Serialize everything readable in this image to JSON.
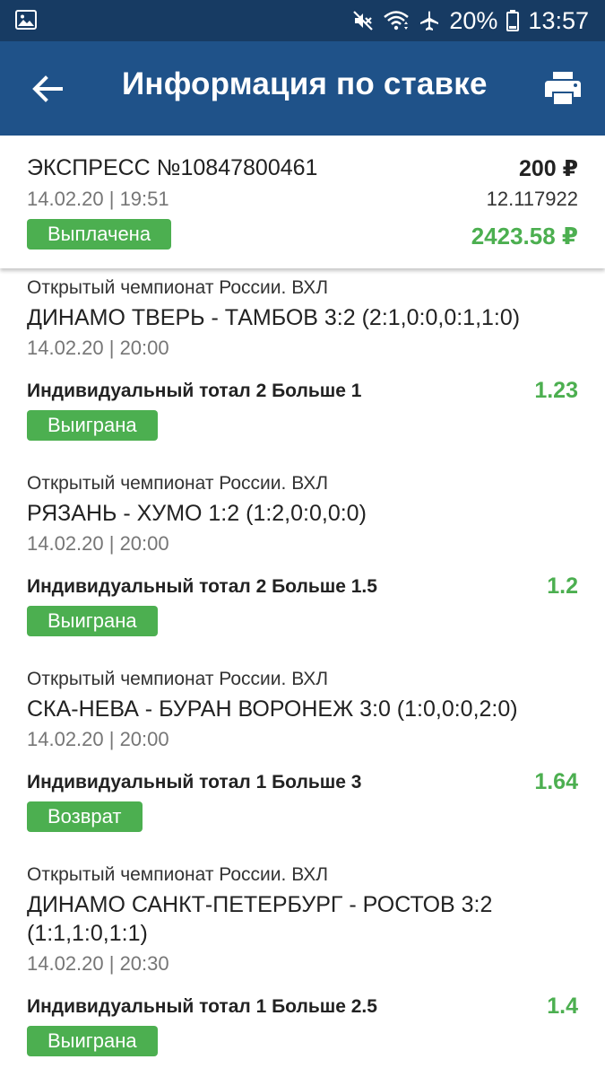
{
  "status_bar": {
    "battery": "20%",
    "time": "13:57",
    "icons": [
      "gallery-icon",
      "mute-icon",
      "wifi-icon",
      "airplane-icon",
      "battery-icon"
    ]
  },
  "app_bar": {
    "title": "Информация по ставке",
    "back_icon": "back-arrow-icon",
    "print_icon": "printer-icon"
  },
  "summary": {
    "bet_name": "ЭКСПРЕСС №10847800461",
    "date": "14.02.20 | 19:51",
    "amount": "200 ₽",
    "coefficient": "12.117922",
    "payout": "2423.58 ₽",
    "status": "Выплачена"
  },
  "events": [
    {
      "league": "Открытый чемпионат России. ВХЛ",
      "match": "ДИНАМО ТВЕРЬ - ТАМБОВ 3:2 (2:1,0:0,0:1,1:0)",
      "date": "14.02.20 | 20:00",
      "market": "Индивидуальный тотал 2 Больше 1",
      "odds": "1.23",
      "status": "Выиграна"
    },
    {
      "league": "Открытый чемпионат России. ВХЛ",
      "match": "РЯЗАНЬ - ХУМО 1:2 (1:2,0:0,0:0)",
      "date": "14.02.20 | 20:00",
      "market": "Индивидуальный тотал 2 Больше 1.5",
      "odds": "1.2",
      "status": "Выиграна"
    },
    {
      "league": "Открытый чемпионат России. ВХЛ",
      "match": "СКА-НЕВА - БУРАН ВОРОНЕЖ 3:0 (1:0,0:0,2:0)",
      "date": "14.02.20 | 20:00",
      "market": "Индивидуальный тотал 1 Больше 3",
      "odds": "1.64",
      "status": "Возврат"
    },
    {
      "league": "Открытый чемпионат России. ВХЛ",
      "match": "ДИНАМО САНКТ-ПЕТЕРБУРГ - РОСТОВ 3:2 (1:1,1:0,1:1)",
      "date": "14.02.20 | 20:30",
      "market": "Индивидуальный тотал 1 Больше 2.5",
      "odds": "1.4",
      "status": "Выиграна"
    }
  ],
  "colors": {
    "status_bar_bg": "#173b63",
    "app_bar_bg": "#1f5289",
    "accent_green": "#4caf50"
  }
}
